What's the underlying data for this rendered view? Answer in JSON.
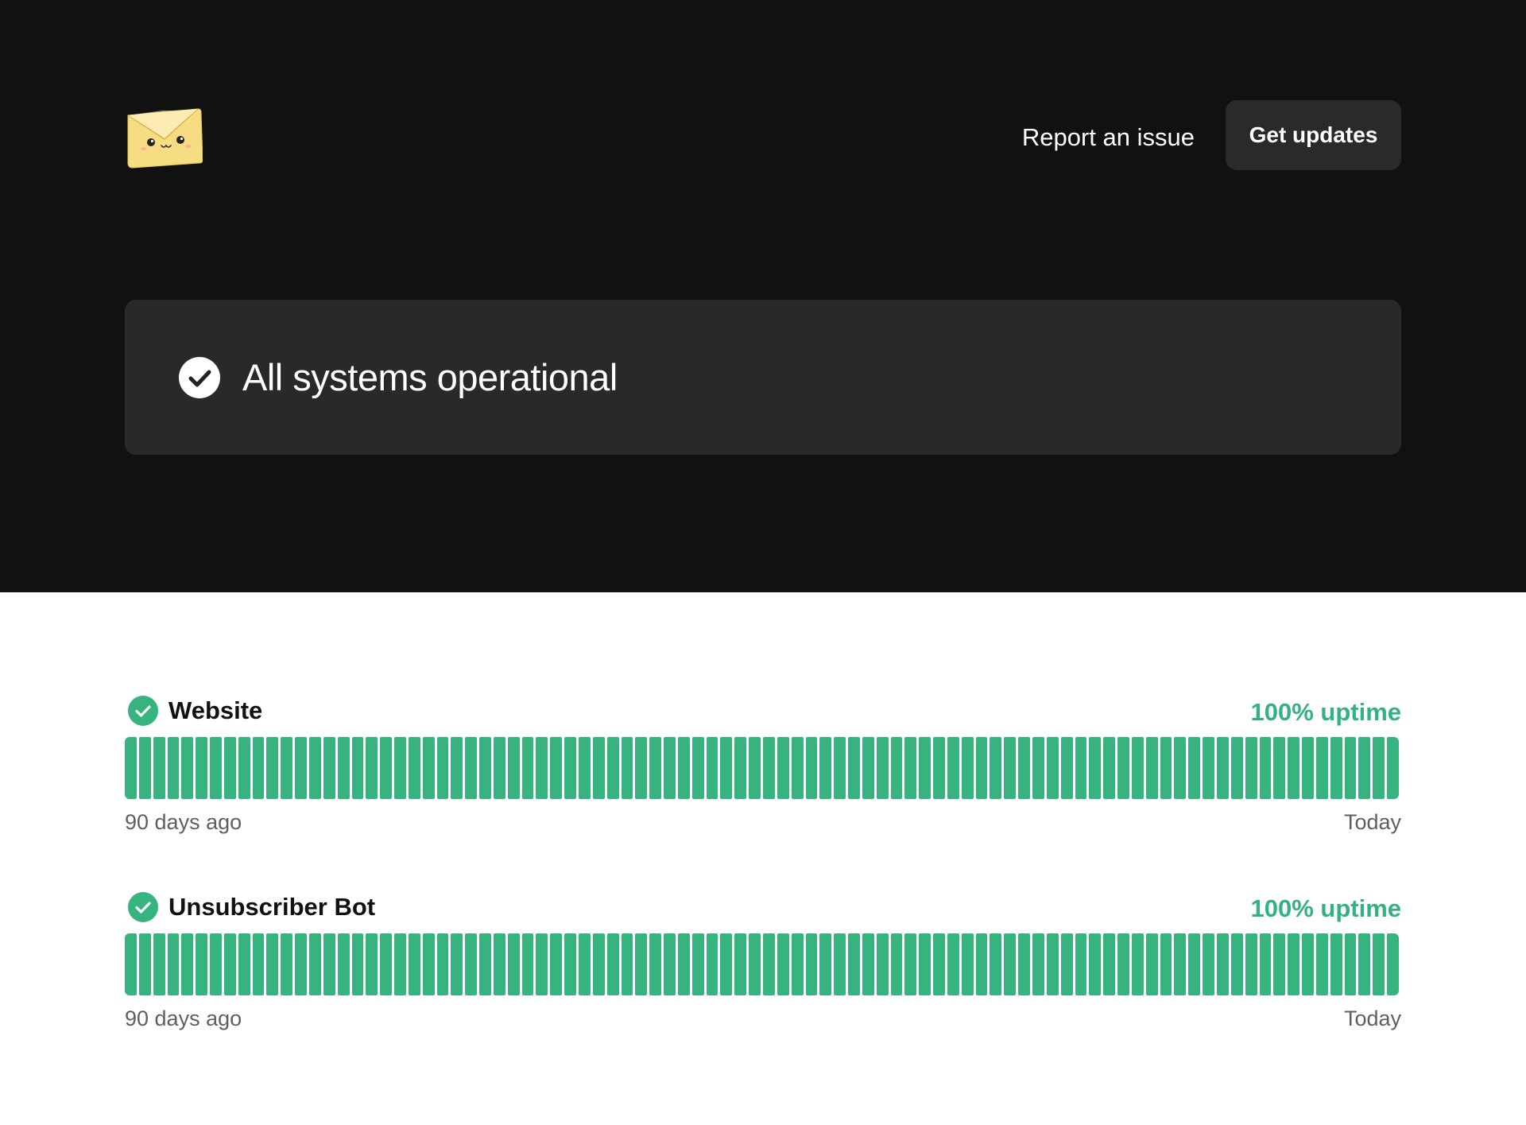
{
  "header": {
    "logo_icon": "envelope-mascot-icon",
    "report_label": "Report an issue",
    "updates_label": "Get updates"
  },
  "status": {
    "icon": "check-circle-icon",
    "text": "All systems operational"
  },
  "colors": {
    "hero_bg": "#111111",
    "card_bg": "#292929",
    "operational_green": "#36b37e",
    "uptime_text": "#33b27f"
  },
  "components": [
    {
      "name": "Website",
      "uptime": "100% uptime",
      "uptime_percent": 100,
      "days": 90,
      "range_start": "90 days ago",
      "range_end": "Today",
      "status_icon": "check-circle-icon"
    },
    {
      "name": "Unsubscriber Bot",
      "uptime": "100% uptime",
      "uptime_percent": 100,
      "days": 90,
      "range_start": "90 days ago",
      "range_end": "Today",
      "status_icon": "check-circle-icon"
    }
  ]
}
